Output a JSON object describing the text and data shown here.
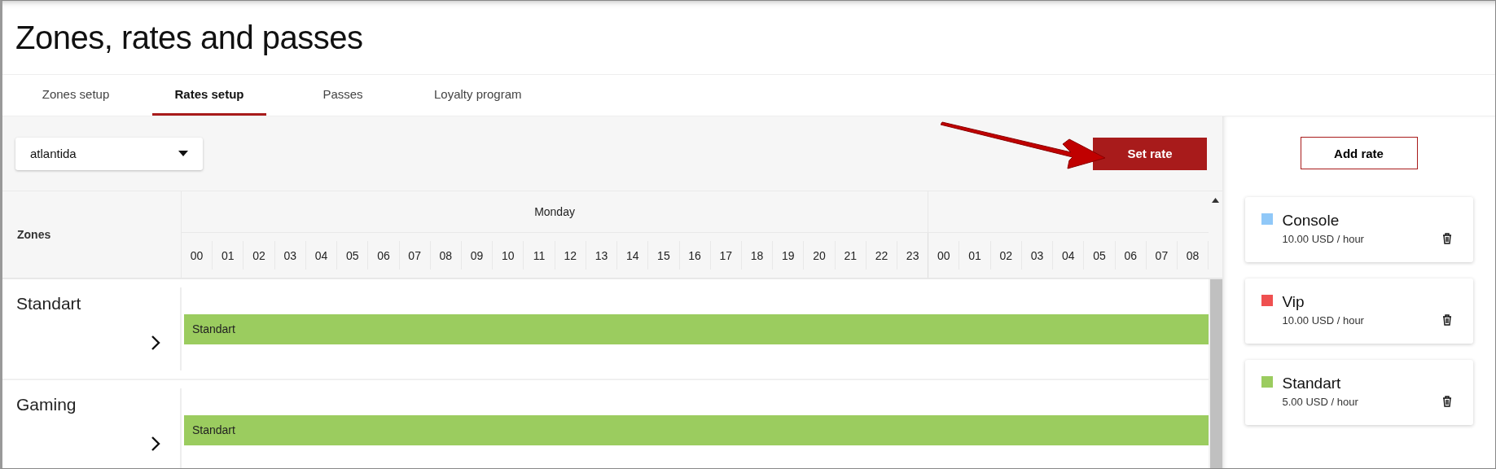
{
  "page": {
    "title": "Zones, rates and passes"
  },
  "tabs": [
    {
      "label": "Zones setup",
      "selected": false
    },
    {
      "label": "Rates setup",
      "selected": true
    },
    {
      "label": "Passes",
      "selected": false
    },
    {
      "label": "Loyalty program",
      "selected": false
    }
  ],
  "location_select": {
    "value": "atlantida"
  },
  "set_rate_button": "Set rate",
  "add_rate_button": "Add rate",
  "schedule": {
    "zones_header": "Zones",
    "day": "Monday",
    "hours": [
      "00",
      "01",
      "02",
      "03",
      "04",
      "05",
      "06",
      "07",
      "08",
      "09",
      "10",
      "11",
      "12",
      "13",
      "14",
      "15",
      "16",
      "17",
      "18",
      "19",
      "20",
      "21",
      "22",
      "23",
      "00",
      "01",
      "02",
      "03",
      "04",
      "05",
      "06",
      "07",
      "08"
    ],
    "rows": [
      {
        "zone": "Standart",
        "bar": {
          "label": "Standart",
          "color": "#9bcc5f"
        }
      },
      {
        "zone": "Gaming",
        "bar": {
          "label": "Standart",
          "color": "#9bcc5f"
        }
      }
    ]
  },
  "rates": [
    {
      "name": "Console",
      "price": "10.00 USD / hour",
      "color": "#90c8f8"
    },
    {
      "name": "Vip",
      "price": "10.00 USD / hour",
      "color": "#ef5050"
    },
    {
      "name": "Standart",
      "price": "5.00 USD / hour",
      "color": "#9bcc5f"
    }
  ]
}
